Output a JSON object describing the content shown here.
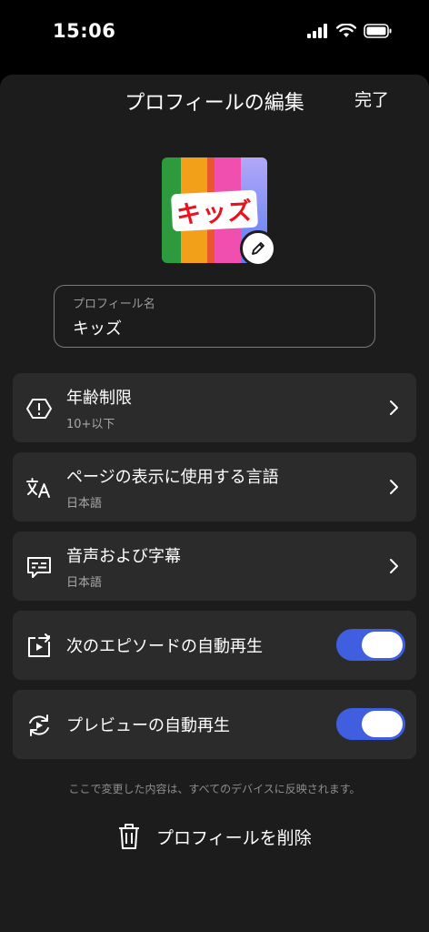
{
  "status_bar": {
    "time": "15:06",
    "icons": [
      "signal-icon",
      "wifi-icon",
      "battery-icon"
    ]
  },
  "header": {
    "title": "プロフィールの編集",
    "done_label": "完了"
  },
  "avatar": {
    "label": "キッズ",
    "stripe_colors": [
      "#2d9a3e",
      "#f2a019",
      "#e8477d",
      "#f04fb0",
      "#7a5cf0"
    ],
    "edit_icon": "pencil-icon"
  },
  "profile_name": {
    "label": "プロフィール名",
    "value": "キッズ"
  },
  "settings": [
    {
      "icon": "warning-hexagon-icon",
      "title": "年齢制限",
      "subtitle": "10+以下",
      "type": "link"
    },
    {
      "icon": "translate-icon",
      "title": "ページの表示に使用する言語",
      "subtitle": "日本語",
      "type": "link"
    },
    {
      "icon": "subtitles-icon",
      "title": "音声および字幕",
      "subtitle": "日本語",
      "type": "link"
    },
    {
      "icon": "autoplay-next-icon",
      "title": "次のエピソードの自動再生",
      "on": true,
      "type": "toggle"
    },
    {
      "icon": "autoplay-preview-icon",
      "title": "プレビューの自動再生",
      "on": true,
      "type": "toggle"
    }
  ],
  "footnote": "ここで変更した内容は、すべてのデバイスに反映されます。",
  "delete": {
    "label": "プロフィールを削除",
    "icon": "trash-icon"
  },
  "colors": {
    "accent": "#3f5fe0",
    "row_bg": "#2b2b2b",
    "sheet_bg": "#1c1c1c"
  }
}
